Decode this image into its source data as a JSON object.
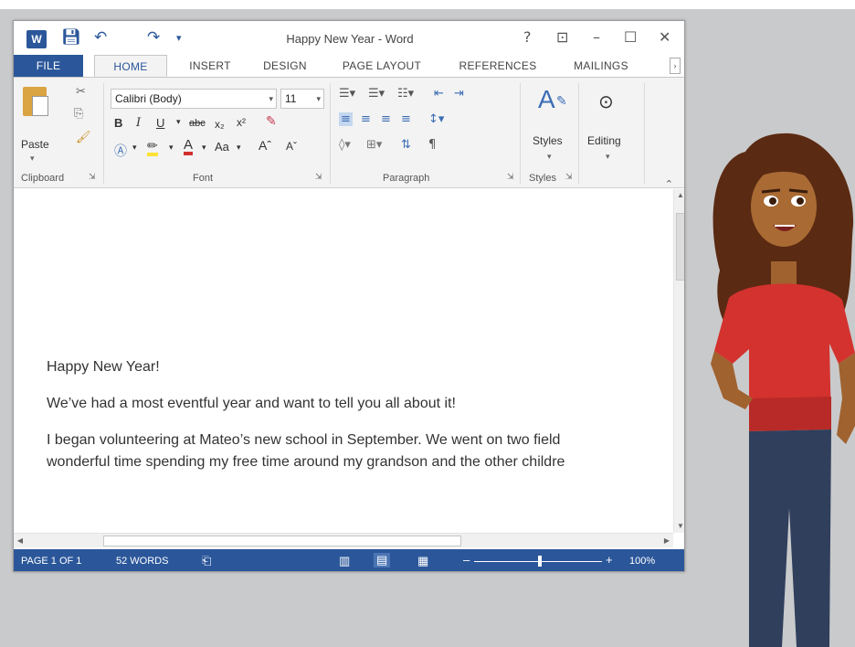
{
  "app": {
    "title": "Happy New Year - Word"
  },
  "window_controls": {
    "help": "?",
    "ribbon_display": "⊡",
    "minimize": "–",
    "maximize": "☐",
    "close": "✕"
  },
  "tabs": [
    {
      "label": "FILE"
    },
    {
      "label": "HOME"
    },
    {
      "label": "INSERT"
    },
    {
      "label": "DESIGN"
    },
    {
      "label": "PAGE LAYOUT"
    },
    {
      "label": "REFERENCES"
    },
    {
      "label": "MAILINGS"
    }
  ],
  "ribbon": {
    "paste_label": "Paste",
    "font_name": "Calibri (Body)",
    "font_size": "11",
    "styles_label": "Styles",
    "editing_label": "Editing",
    "groups": [
      {
        "label": "Clipboard"
      },
      {
        "label": "Font"
      },
      {
        "label": "Paragraph"
      },
      {
        "label": "Styles"
      }
    ]
  },
  "document": {
    "paragraphs": [
      "Happy New Year!",
      "We’ve had a most eventful year and want to tell you all about it!",
      "I began volunteering at Mateo’s new school in September.  We went on two field",
      "wonderful time spending my free time around my grandson and the other childre"
    ]
  },
  "status": {
    "page": "PAGE 1 OF 1",
    "words": "52 WORDS",
    "zoom": "100%"
  },
  "colors": {
    "word_blue": "#2b579a",
    "shirt_red": "#d3322e",
    "jeans": "#2f3f5c"
  }
}
